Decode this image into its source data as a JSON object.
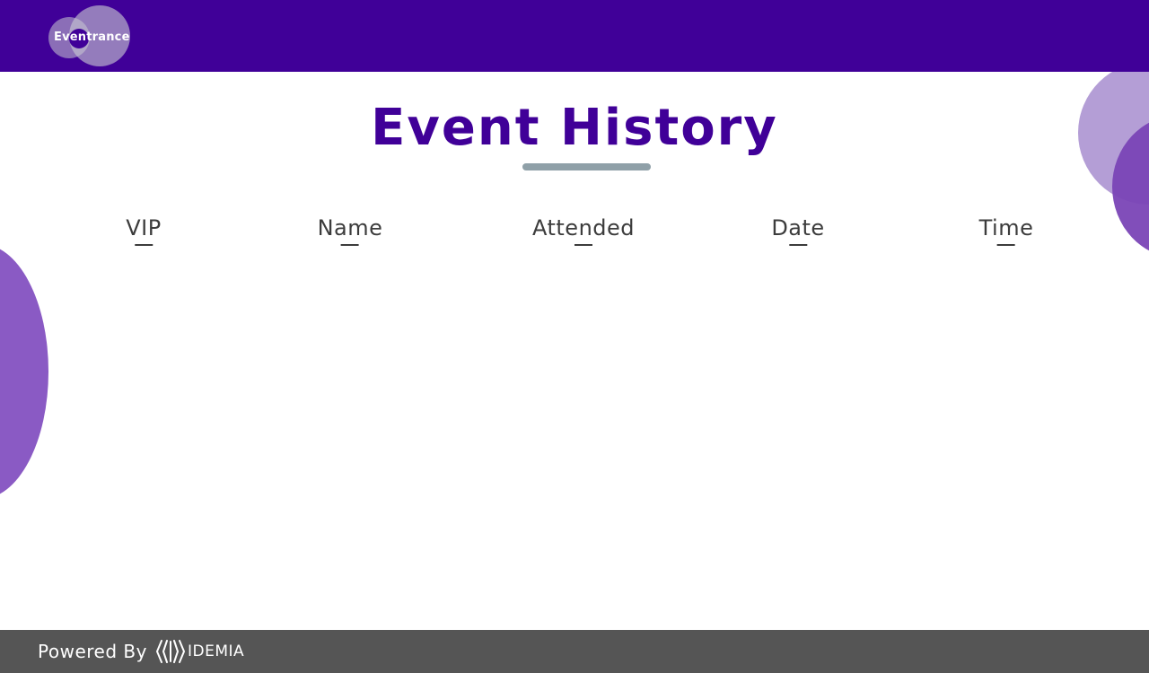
{
  "app": {
    "logo_text": "Eventrance"
  },
  "page": {
    "title": "Event History"
  },
  "table": {
    "columns": [
      {
        "label": "VIP"
      },
      {
        "label": "Name"
      },
      {
        "label": "Attended"
      },
      {
        "label": "Date"
      },
      {
        "label": "Time"
      }
    ],
    "rows": []
  },
  "footer": {
    "powered_by": "Powered By",
    "brand_name": "IDEMIA"
  },
  "colors": {
    "header_bg": "#400098",
    "title": "#400098",
    "footer_bg": "#555555",
    "accent_blob": "#8a5ac4"
  },
  "icons": {
    "logo": "eventrance-logo-icon",
    "brand": "idemia-logo-icon"
  }
}
